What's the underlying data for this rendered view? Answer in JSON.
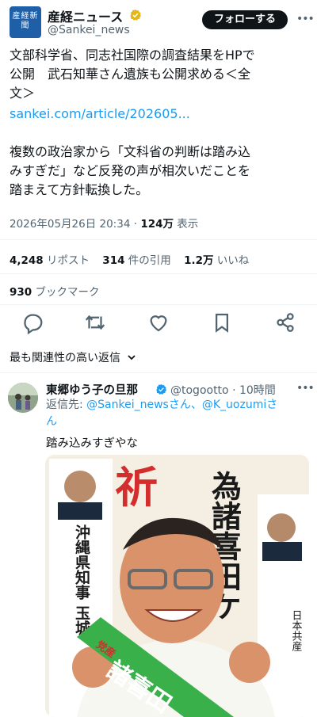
{
  "header": {
    "logo_text": "産経新聞",
    "account_name": "産経ニュース",
    "account_handle": "@Sankei_news",
    "follow_label": "フォローする",
    "more_icon": "more-dots-icon"
  },
  "tweet": {
    "line1": "文部科学省、同志社国際の調査結果をHPで",
    "line2": "公開　武石知華さん遺族も公開求める＜全",
    "line3": "文＞",
    "link": "sankei.com/article/202605...",
    "line4": "複数の政治家から「文科省の判断は踏み込",
    "line5": "みすぎだ」など反発の声が相次いだことを",
    "line6": "踏まえて方針転換した。",
    "timestamp": "2026年05月26日 20:34",
    "sep": "·",
    "views_count": "124万",
    "views_label": "表示"
  },
  "stats": {
    "reposts_count": "4,248",
    "reposts_label": "リポスト",
    "quotes_count": "314",
    "quotes_label": "件の引用",
    "likes_count": "1.2万",
    "likes_label": "いいね",
    "bookmarks_count": "930",
    "bookmarks_label": "ブックマーク"
  },
  "actions": [
    "reply-icon",
    "repost-icon",
    "like-icon",
    "bookmark-icon",
    "share-icon"
  ],
  "sort": {
    "label": "最も関連性の高い返信",
    "chevron": "chevron-down-icon"
  },
  "reply": {
    "name": "東郷ゆう子の旦那",
    "handle": "@togootto",
    "sep": "·",
    "time": "10時間",
    "reply_to_label": "返信先:",
    "reply_to_users": "@Sankei_newsさん、@K_uozumiさ",
    "reply_to_users_2": "ん",
    "text": "踏み込みすぎやな",
    "photo": {
      "banner_top": "祈",
      "banner_right": "為諸喜田ケ",
      "poster_left": "沖縄県知事 玉城",
      "poster_right": "日本共産",
      "sash_line1": "諸喜田",
      "sash_small": "党産"
    }
  },
  "colors": {
    "accent": "#1d9bf0",
    "text": "#0f1419",
    "muted": "#536471",
    "gold": "#e2b719"
  }
}
